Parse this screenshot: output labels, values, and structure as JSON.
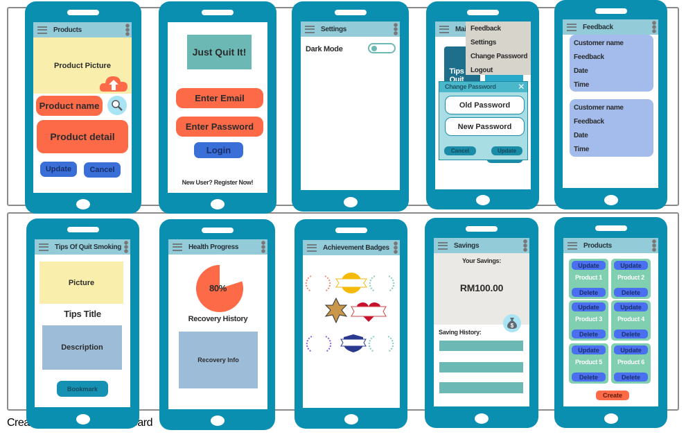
{
  "caption": {
    "left": "Crea",
    "right": "oard"
  },
  "products_edit": {
    "title": "Products",
    "picture": "Product Picture",
    "name": "Product name",
    "detail": "Product detail",
    "update": "Update",
    "cancel": "Cancel"
  },
  "login": {
    "logo": "Just Quit It!",
    "email": "Enter Email",
    "password": "Enter Password",
    "login": "Login",
    "register": "New User? Register Now!"
  },
  "settings": {
    "title": "Settings",
    "dark_mode": "Dark Mode",
    "dark_mode_on": false
  },
  "main": {
    "title": "Mai",
    "tile": "Tips Quit",
    "menu": [
      "Feedback",
      "Settings",
      "Change Password",
      "Logout"
    ],
    "dialog": {
      "title": "Change Password",
      "old": "Old Password",
      "new": "New Password",
      "cancel": "Cancel",
      "update": "Update"
    }
  },
  "feedback": {
    "title": "Feedback",
    "cards": [
      {
        "name": "Customer name",
        "feedback": "Feedback",
        "date": "Date",
        "time": "Time"
      },
      {
        "name": "Customer name",
        "feedback": "Feedback",
        "date": "Date",
        "time": "Time"
      }
    ]
  },
  "tips": {
    "title": "Tips Of Quit Smoking",
    "picture": "Picture",
    "tips_title": "Tips Title",
    "description": "Description",
    "bookmark": "Bookmark"
  },
  "health": {
    "title": "Health Progress",
    "progress_percent": 80,
    "progress_label": "80%",
    "history": "Recovery History",
    "info": "Recovery Info"
  },
  "badges": {
    "title": "Achievement Badges",
    "items": [
      "laurel-orange",
      "gold-seal-ribbon",
      "laurel-teal",
      "sheriff-star",
      "heart-ribbon",
      "laurel-purple",
      "shield-ribbon",
      "laurel-teal"
    ]
  },
  "savings": {
    "title": "Savings",
    "label": "Your Savings:",
    "amount": "RM100.00",
    "history": "Saving History:"
  },
  "products": {
    "title": "Products",
    "items": [
      "Product 1",
      "Product 2",
      "Product 3",
      "Product 4",
      "Product 5",
      "Product 6"
    ],
    "update": "Update",
    "delete": "Delete",
    "create": "Create"
  },
  "colors": {
    "phone": "#0b8fb0",
    "header": "#93cbd9",
    "orange": "#fc6a48",
    "blue": "#3a6fd8",
    "yellow": "#f9eeac",
    "teal": "#6cb8b4",
    "card": "#a3bcec",
    "green": "#7fcfb0"
  }
}
